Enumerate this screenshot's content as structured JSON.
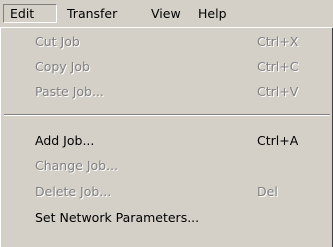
{
  "menubar": {
    "items": [
      {
        "label": "Edit",
        "active": true
      },
      {
        "label": "Transfer"
      },
      {
        "label": "View"
      },
      {
        "label": "Help"
      }
    ]
  },
  "dropdown": {
    "items": [
      {
        "label": "Cut Job",
        "shortcut": "Ctrl+X",
        "enabled": false
      },
      {
        "label": "Copy Job",
        "shortcut": "Ctrl+C",
        "enabled": false
      },
      {
        "label": "Paste Job...",
        "shortcut": "Ctrl+V",
        "enabled": false
      },
      {
        "label": "Add Job...",
        "shortcut": "Ctrl+A",
        "enabled": true
      },
      {
        "label": "Change Job...",
        "shortcut": "",
        "enabled": false
      },
      {
        "label": "Delete Job...",
        "shortcut": "Del",
        "enabled": false
      },
      {
        "label": "Set Network Parameters...",
        "shortcut": "",
        "enabled": true
      }
    ]
  }
}
